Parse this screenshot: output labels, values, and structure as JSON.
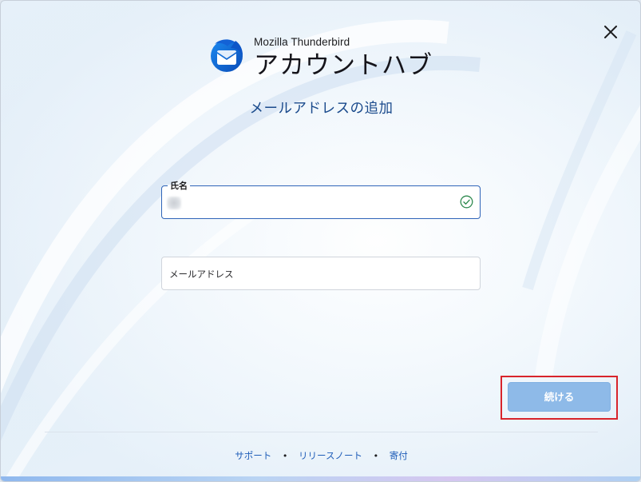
{
  "brand": {
    "product_name": "Mozilla Thunderbird",
    "hub_title": "アカウントハブ"
  },
  "page": {
    "heading": "メールアドレスの追加"
  },
  "form": {
    "name_field": {
      "label": "氏名",
      "value_blurred": true,
      "validation": "valid"
    },
    "email_field": {
      "placeholder": "メールアドレス",
      "value": ""
    }
  },
  "actions": {
    "continue_label": "続ける",
    "continue_enabled": false
  },
  "footer": {
    "links": [
      "サポート",
      "リリースノート",
      "寄付"
    ],
    "separator": "•"
  },
  "icons": {
    "close": "close-icon",
    "logo": "thunderbird-logo-icon",
    "valid": "check-circle-icon"
  },
  "colors": {
    "accent": "#1a4a8c",
    "link": "#1e5db8",
    "field_focus_border": "#2f64b8",
    "button_disabled": "#8ebae8",
    "highlight": "#d8242b",
    "valid": "#2e8a4f"
  }
}
